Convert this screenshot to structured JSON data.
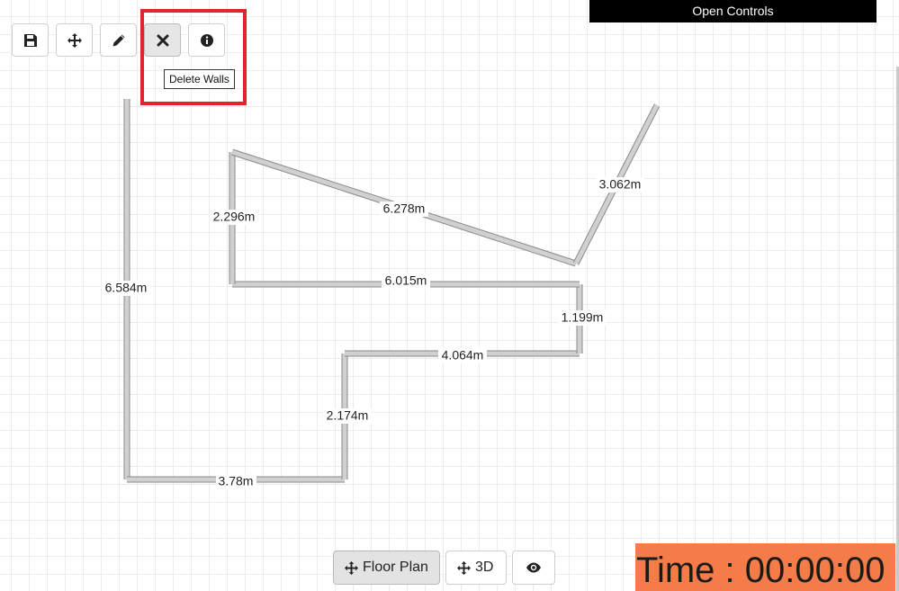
{
  "toolbar": {
    "buttons": [
      {
        "icon": "save-icon",
        "label": "Save"
      },
      {
        "icon": "move-icon",
        "label": "Move"
      },
      {
        "icon": "pencil-icon",
        "label": "Draw Walls"
      },
      {
        "icon": "close-icon",
        "label": "Delete Walls"
      },
      {
        "icon": "info-icon",
        "label": "Info"
      }
    ],
    "tooltip": "Delete Walls"
  },
  "open_controls": "Open Controls",
  "walls": {
    "labels": {
      "w1": "6.584m",
      "w2": "3.78m",
      "w3": "2.174m",
      "w4": "4.064m",
      "w5": "1.199m",
      "w6": "6.015m",
      "w7": "2.296m",
      "w8": "6.278m",
      "w9": "3.062m"
    }
  },
  "view_bar": {
    "floor_plan": "Floor Plan",
    "three_d": "3D"
  },
  "timer": "Time : 00:00:00",
  "colors": {
    "highlight": "#e0252c",
    "timer_bg": "#f47c48",
    "open_controls_bg": "#000000"
  }
}
